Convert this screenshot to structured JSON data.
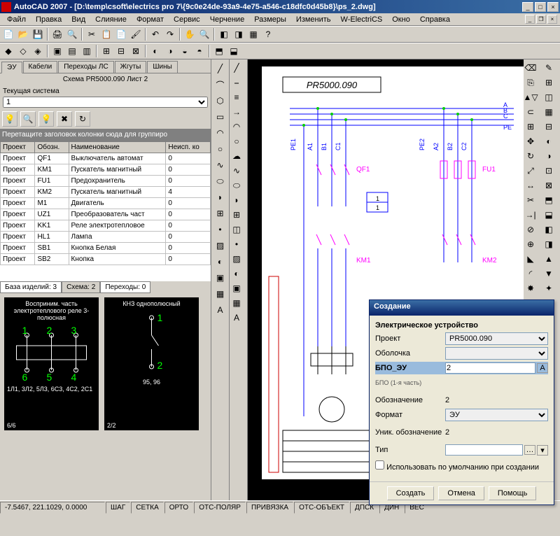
{
  "title": "AutoCAD 2007 - [D:\\temp\\csoft\\electrics pro 7\\{9c0e24de-93a9-4e75-a546-c18dfc0d45b8}\\ps_2.dwg]",
  "menu": [
    "Файл",
    "Правка",
    "Вид",
    "Слияние",
    "Формат",
    "Сервис",
    "Черчение",
    "Размеры",
    "Изменить",
    "W-ElectriCS",
    "Окно",
    "Справка"
  ],
  "leftpanel": {
    "tabs": [
      "ЭУ",
      "Кабели",
      "Переходы ЛС",
      "Жгуты",
      "Шины"
    ],
    "scheme": "Схема PR5000.090 Лист 2",
    "sys_label": "Текущая система",
    "sys_value": "1",
    "grouphint": "Перетащите заголовок колонки сюда для группиро",
    "grid": {
      "cols": [
        "Проект",
        "Обозн.",
        "Наименование",
        "Неисп. ко"
      ],
      "rows": [
        [
          "Проект",
          "QF1",
          "Выключатель автомат",
          "0"
        ],
        [
          "Проект",
          "KM1",
          "Пускатель магнитный",
          "0"
        ],
        [
          "Проект",
          "FU1",
          "Предохранитель",
          "0"
        ],
        [
          "Проект",
          "KM2",
          "Пускатель магнитный",
          "4"
        ],
        [
          "Проект",
          "M1",
          "Двигатель",
          "0"
        ],
        [
          "Проект",
          "UZ1",
          "Преобразователь част",
          "0"
        ],
        [
          "Проект",
          "KK1",
          "Реле электротепловое",
          "0"
        ],
        [
          "Проект",
          "HL1",
          "Лампа",
          "0"
        ],
        [
          "Проект",
          "SB1",
          "Кнопка Белая",
          "0"
        ],
        [
          "Проект",
          "SB2",
          "Кнопка",
          "0"
        ]
      ]
    },
    "btabs": [
      "База изделий: 3",
      "Схема: 2",
      "Переходы: 0"
    ],
    "preview1": {
      "title": "Восприним. часть электротеплового реле 3-полюсная",
      "pins_top": [
        "1",
        "2",
        "3"
      ],
      "pins_bot": [
        "6",
        "5",
        "4"
      ],
      "bottom_text": "1Л1, 3Л2, 5Л3, 6С3, 4С2, 2С1",
      "count": "6/6"
    },
    "preview2": {
      "title": "КНЗ однополюсный",
      "pins": [
        "1",
        "2"
      ],
      "bottom_text": "95, 96",
      "count": "2/2"
    }
  },
  "drawing": {
    "title_box": "PR5000.090",
    "buses": [
      "A",
      "B",
      "C",
      "PE"
    ],
    "labels_left": [
      "PE1",
      "A1",
      "B1",
      "C1"
    ],
    "labels_right": [
      "PE2",
      "A2",
      "B2",
      "C2"
    ],
    "qf1": "QF1",
    "fu1": "FU1",
    "km1": "KM1",
    "km2": "KM2"
  },
  "dialog": {
    "title": "Создание",
    "heading": "Электрическое устройство",
    "fields": {
      "project_l": "Проект",
      "project_v": "PR5000.090",
      "shell_l": "Оболочка",
      "bpo_l": "БПО_ЭУ",
      "bpo_v": "2",
      "bpo_hint": "БПО (1-я часть)",
      "desig_l": "Обозначение",
      "desig_v": "2",
      "format_l": "Формат",
      "format_v": "ЭУ",
      "uniq_l": "Уник. обозначение",
      "uniq_v": "2",
      "type_l": "Тип",
      "type_v": ""
    },
    "checkbox": "Использовать по умолчанию при создании",
    "btn_create": "Создать",
    "btn_cancel": "Отмена",
    "btn_help": "Помощь"
  },
  "status": {
    "coord": "-7.5467, 221.1029, 0.0000",
    "modes": [
      "ШАГ",
      "СЕТКА",
      "ОРТО",
      "ОТС-ПОЛЯР",
      "ПРИВЯЗКА",
      "ОТС-ОБЪЕКТ",
      "ДПСК",
      "ДИН",
      "ВЕС"
    ]
  }
}
